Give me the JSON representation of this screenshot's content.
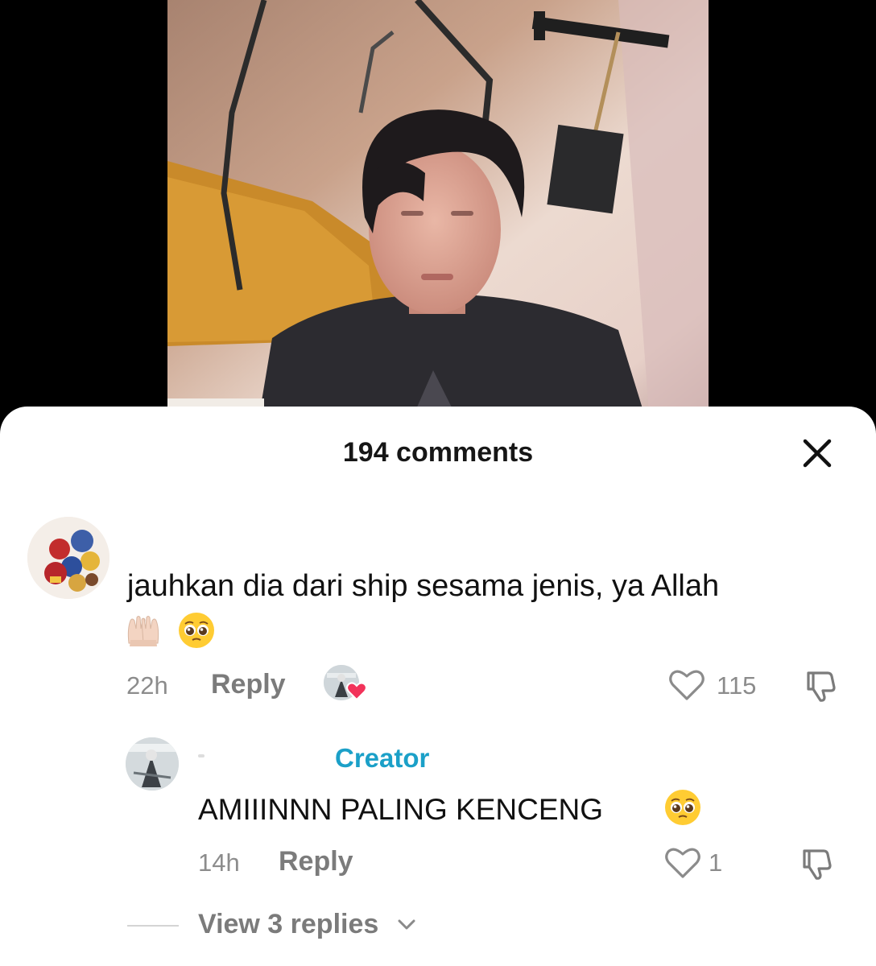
{
  "video": {
    "background": "#000000",
    "frame_colors": [
      "#b08a73",
      "#ead7cc",
      "#c9a9a5",
      "#c98a2a",
      "#2a2a2e"
    ]
  },
  "comments_sheet": {
    "title": "194 comments",
    "close_icon": "close-icon",
    "comments": [
      {
        "avatar": "user-avatar",
        "text": "jauhkan dia dari ship sesama jenis, ya Allah",
        "emojis": [
          "raising-hands-emoji",
          "pleading-face-emoji"
        ],
        "time": "22h",
        "reply_label": "Reply",
        "creator_liked": true,
        "likes": "115",
        "like_icon": "heart-outline-icon",
        "dislike_icon": "thumbs-down-icon",
        "replies": [
          {
            "badge": "Creator",
            "text": "AMIIINNN PALING KENCENG",
            "emoji": "pleading-face-emoji",
            "time": "14h",
            "reply_label": "Reply",
            "likes": "1"
          }
        ],
        "view_replies": "View 3 replies"
      }
    ],
    "colors": {
      "creator_badge": "#1ba0c8",
      "liked_heart": "#f2335a",
      "secondary_text": "#8c8c8c"
    }
  }
}
